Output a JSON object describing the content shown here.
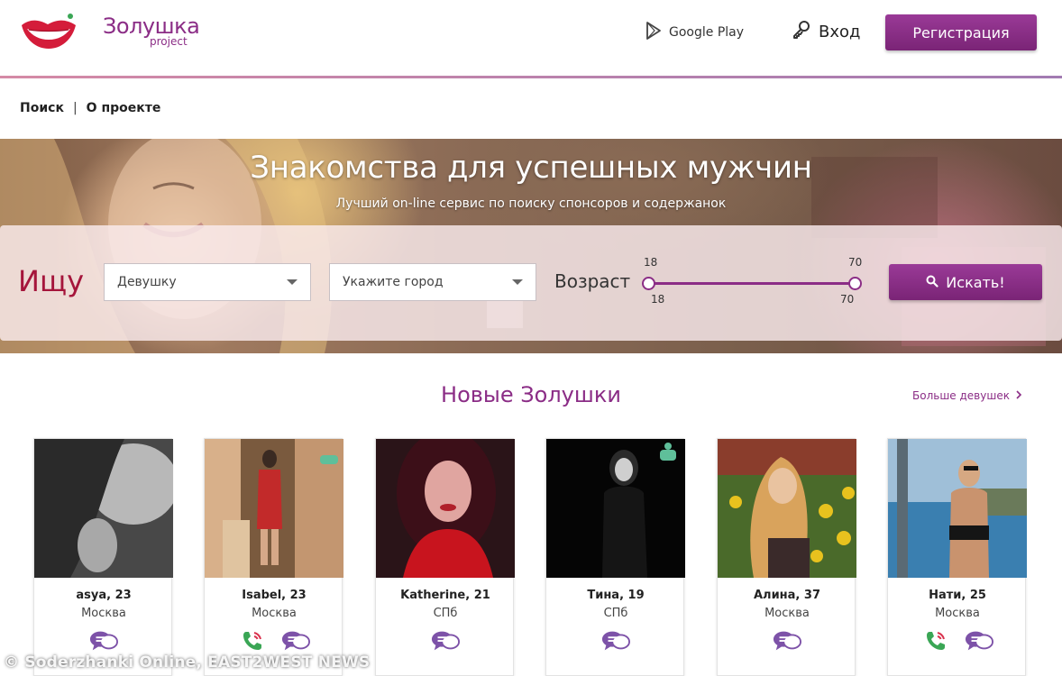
{
  "header": {
    "logo_title": "Золушка",
    "logo_sub": "project",
    "google_play": "Google Play",
    "login": "Вход",
    "register": "Регистрация"
  },
  "nav": {
    "items": [
      "Поиск",
      "О проекте"
    ],
    "separator": "|"
  },
  "hero": {
    "title": "Знакомства для успешных мужчин",
    "subtitle": "Лучший on-line сервис по поиску спонсоров и содержанок"
  },
  "search": {
    "label": "Ищу",
    "gender_value": "Девушку",
    "city_placeholder": "Укажите город",
    "age_label": "Возраст",
    "age_min": "18",
    "age_max": "70",
    "age_min_value": "18",
    "age_max_value": "70",
    "button": "Искать!"
  },
  "section": {
    "title": "Новые Золушки",
    "more_link": "Больше девушек"
  },
  "cards": [
    {
      "name": "asya, 23",
      "city": "Москва",
      "phone": false
    },
    {
      "name": "Isabel, 23",
      "city": "Москва",
      "phone": true
    },
    {
      "name": "Katherine, 21",
      "city": "СПб",
      "phone": false
    },
    {
      "name": "Тина, 19",
      "city": "СПб",
      "phone": false
    },
    {
      "name": "Алина, 37",
      "city": "Москва",
      "phone": false
    },
    {
      "name": "Нати, 25",
      "city": "Москва",
      "phone": true
    }
  ],
  "watermark": "© Soderzhanki Online, EAST2WEST NEWS",
  "colors": {
    "brand": "#8b2d86",
    "accent_red": "#a5153b",
    "phone_green": "#3aa655"
  },
  "icons": {
    "google_play": "play-icon",
    "login": "key-icon",
    "search": "search-icon",
    "chat": "chat-bubbles-icon",
    "phone": "phone-icon",
    "more": "chevron-right-icon"
  }
}
